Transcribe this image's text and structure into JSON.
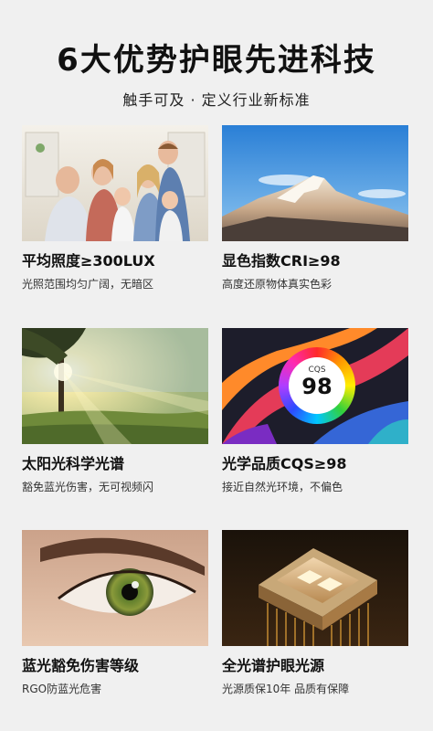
{
  "title": "6大优势护眼先进科技",
  "subtitle": "触手可及 · 定义行业新标准",
  "features": [
    {
      "heading": "平均照度≥300LUX",
      "desc": "光照范围均匀广阔，无暗区"
    },
    {
      "heading": "显色指数CRI≥98",
      "desc": "高度还原物体真实色彩"
    },
    {
      "heading": "太阳光科学光谱",
      "desc": "豁免蓝光伤害，无可视频闪"
    },
    {
      "heading": "光学品质CQS≥98",
      "desc": "接近自然光环境，不偏色"
    },
    {
      "heading": "蓝光豁免伤害等级",
      "desc": "RGO防蓝光危害"
    },
    {
      "heading": "全光谱护眼光源",
      "desc": "光源质保10年 品质有保障"
    }
  ],
  "cqs_badge": {
    "label": "CQS",
    "value": "98"
  }
}
